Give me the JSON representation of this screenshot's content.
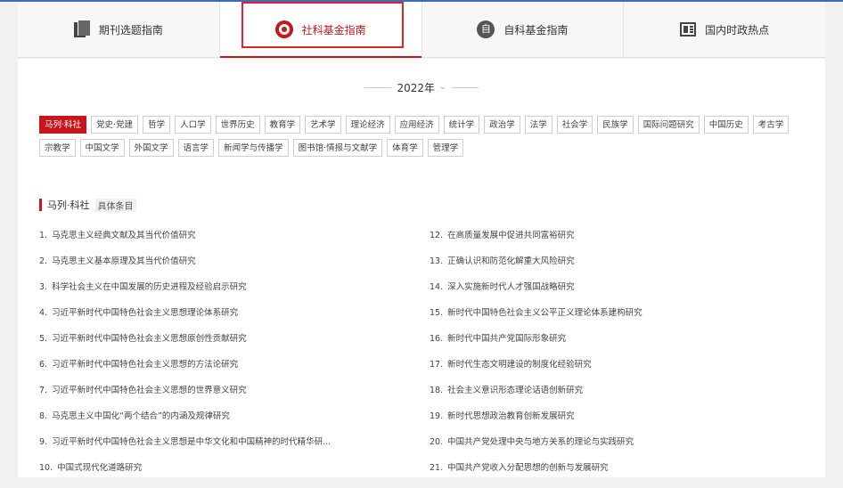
{
  "tabs": [
    {
      "label": "期刊选题指南",
      "icon": "journal-stack-icon",
      "active": false
    },
    {
      "label": "社科基金指南",
      "icon": "target-icon",
      "active": true
    },
    {
      "label": "自科基金指南",
      "icon": "zi-circle-icon",
      "icon_char": "自",
      "active": false
    },
    {
      "label": "国内时政热点",
      "icon": "newspaper-icon",
      "active": false
    }
  ],
  "year_selector": {
    "value": "2022年",
    "caret": "⌄"
  },
  "subjects": [
    "马列·科社",
    "党史·党建",
    "哲学",
    "人口学",
    "世界历史",
    "教育学",
    "艺术学",
    "理论经济",
    "应用经济",
    "统计学",
    "政治学",
    "法学",
    "社会学",
    "民族学",
    "国际问题研究",
    "中国历史",
    "考古学",
    "宗教学",
    "中国文学",
    "外国文学",
    "语言学",
    "新闻学与传播学",
    "图书馆·情报与文献学",
    "体育学",
    "管理学"
  ],
  "active_subject_index": 0,
  "section": {
    "title": "马列·科社",
    "subtitle": "具体条目"
  },
  "items_left": [
    {
      "num": "1.",
      "text": "马克思主义经典文献及其当代价值研究"
    },
    {
      "num": "2.",
      "text": "马克思主义基本原理及其当代价值研究"
    },
    {
      "num": "3.",
      "text": "科学社会主义在中国发展的历史进程及经验启示研究"
    },
    {
      "num": "4.",
      "text": "习近平新时代中国特色社会主义思想理论体系研究"
    },
    {
      "num": "5.",
      "text": "习近平新时代中国特色社会主义思想原创性贡献研究"
    },
    {
      "num": "6.",
      "text": "习近平新时代中国特色社会主义思想的方法论研究"
    },
    {
      "num": "7.",
      "text": "习近平新时代中国特色社会主义思想的世界意义研究"
    },
    {
      "num": "8.",
      "text": "马克思主义中国化“两个结合”的内涵及规律研究"
    },
    {
      "num": "9.",
      "text": "习近平新时代中国特色社会主义思想是中华文化和中国精神的时代精华研..."
    },
    {
      "num": "10.",
      "text": "中国式现代化道路研究"
    }
  ],
  "items_right": [
    {
      "num": "12.",
      "text": "在高质量发展中促进共同富裕研究"
    },
    {
      "num": "13.",
      "text": "正确认识和防范化解重大风险研究"
    },
    {
      "num": "14.",
      "text": "深入实施新时代人才强国战略研究"
    },
    {
      "num": "15.",
      "text": "新时代中国特色社会主义公平正义理论体系建构研究"
    },
    {
      "num": "16.",
      "text": "新时代中国共产党国际形象研究"
    },
    {
      "num": "17.",
      "text": "新时代生态文明建设的制度化经验研究"
    },
    {
      "num": "18.",
      "text": "社会主义意识形态理论话语创新研究"
    },
    {
      "num": "19.",
      "text": "新时代思想政治教育创新发展研究"
    },
    {
      "num": "20.",
      "text": "中国共产党处理中央与地方关系的理论与实践研究"
    },
    {
      "num": "21.",
      "text": "中国共产党收入分配思想的创新与发展研究"
    }
  ],
  "colors": {
    "accent": "#c8161d",
    "highlight_box": "#e0242a",
    "top_line": "#3b6fb5"
  }
}
